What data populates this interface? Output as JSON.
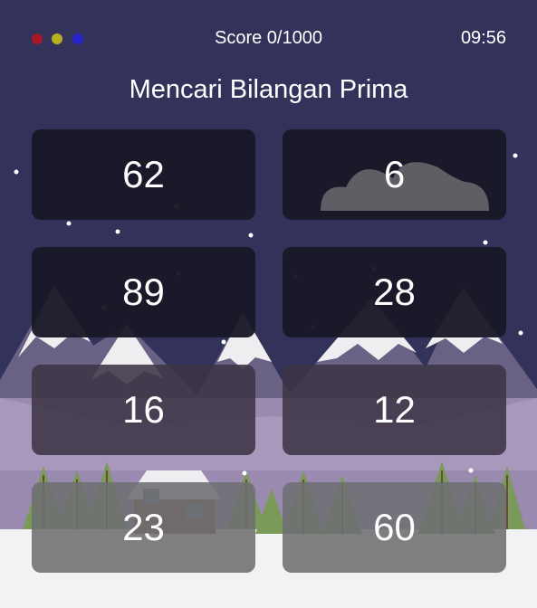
{
  "header": {
    "score": "Score 0/1000",
    "timer": "09:56",
    "dots": {
      "red": "#a81828",
      "yellow": "#b8b020",
      "blue": "#2424c8"
    }
  },
  "title": "Mencari Bilangan Prima",
  "cards": [
    "62",
    "6",
    "89",
    "28",
    "16",
    "12",
    "23",
    "60"
  ],
  "colors": {
    "sky": "#32325a",
    "snow": "#f0f0f0",
    "mountain": "#5d5570",
    "tree": "#7a9a5a",
    "house": "#7a4a30"
  }
}
